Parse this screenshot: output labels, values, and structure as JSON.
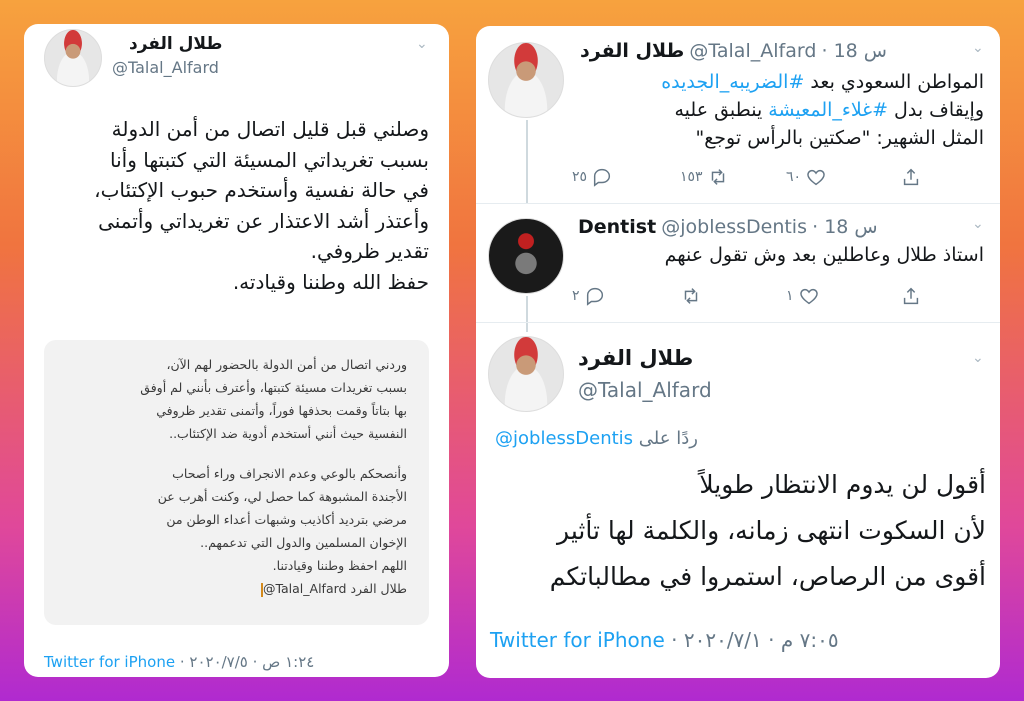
{
  "left_tweet": {
    "name": "طلال الفرد",
    "handle": "@Talal_Alfard",
    "text_lines": [
      "وصلني قبل قليل اتصال من أمن الدولة",
      "بسبب تغريداتي المسيئة التي كتبتها وأنا",
      "في حالة نفسية وأستخدم حبوب الإكتئاب،",
      "وأعتذر أشد الاعتذار عن تغريداتي وأتمنى",
      "تقدير ظروفي.",
      "حفظ الله وطننا وقيادته."
    ],
    "image_lines": [
      "وردني اتصال من أمن الدولة بالحضور لهم الآن،",
      "بسبب تغريدات مسيئة كتبتها، وأعترف بأنني لم أوفق",
      "بها بتاتاً وقمت بحذفها فوراً، وأتمنى تقدير ظروفي",
      "النفسية حيث أنني أستخدم أدوية ضد الإكتئاب..",
      "",
      "وأنصحكم بالوعي وعدم الانجراف وراء أصحاب",
      "الأجندة المشبوهة كما حصل لي، وكنت أهرب عن",
      "مرضي بترديد أكاذيب وشبهات أعداء الوطن من",
      "الإخوان المسلمين والدول التي تدعمهم..",
      "اللهم احفظ وطننا وقيادتنا.",
      "طلال الفرد"
    ],
    "image_signature_handle": "@Talal_Alfard",
    "footer_time": "١:٢٤ ص · ٢٠٢٠/٧/٥ · ",
    "footer_app": "Twitter for iPhone"
  },
  "right_tweets": {
    "tweet1": {
      "name": "طلال الفرد",
      "handle": "@Talal_Alfard",
      "time": "18 س",
      "line1_pre": "المواطن السعودي بعد ",
      "line1_tag": "#الضريبه_الجديده",
      "line2_pre": "وإيقاف بدل ",
      "line2_tag": "#غلاء_المعيشة",
      "line2_post": " ينطبق عليه",
      "line3": "المثل الشهير: \"صكتين بالرأس توجع\"",
      "replies": "٢٥",
      "retweets": "١٥٣",
      "likes": "٦٠"
    },
    "tweet2": {
      "name": "Dentist",
      "handle": "@joblessDentis",
      "time": "18 س",
      "text": "استاذ طلال وعاطلين بعد وش تقول عنهم",
      "replies": "٢",
      "retweets": "",
      "likes": "١"
    },
    "tweet3": {
      "name": "طلال الفرد",
      "handle": "@Talal_Alfard",
      "reply_to_label": "ردًا على",
      "reply_to_handle": "@joblessDentis",
      "text_lines": [
        "أقول لن يدوم الانتظار طويلاً",
        "لأن السكوت انتهى زمانه، والكلمة لها تأثير",
        "أقوى من الرصاص، استمروا في مطالباتكم"
      ],
      "footer_time": "٧:٠٥ م · ٢٠٢٠/٧/١ · ",
      "footer_app": "Twitter for iPhone"
    }
  },
  "colors": {
    "link_blue": "#1da1f2",
    "text": "#14171a",
    "muted": "#657786"
  }
}
